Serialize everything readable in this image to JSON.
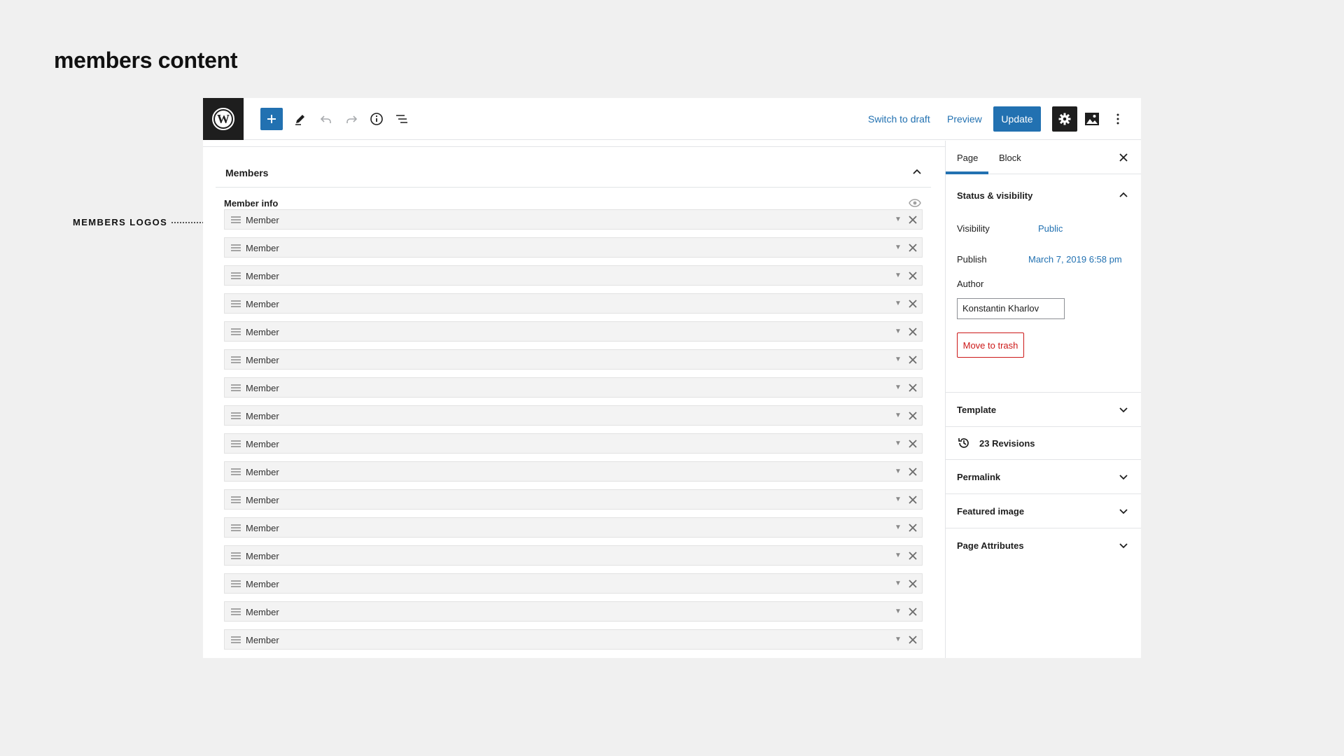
{
  "page_heading": "members content",
  "annotation": {
    "label": "MEMBERS LOGOS"
  },
  "colors": {
    "accent": "#2271b1",
    "danger": "#cc1818",
    "dark": "#1e1e1e"
  },
  "toolbar": {
    "switch_to_draft": "Switch to draft",
    "preview": "Preview",
    "update": "Update",
    "icons": [
      "wordpress-logo-icon",
      "plus-icon",
      "pencil-icon",
      "undo-icon",
      "redo-icon",
      "info-icon",
      "list-view-icon",
      "gear-icon",
      "image-icon",
      "more-vertical-icon"
    ]
  },
  "members_panel": {
    "title": "Members",
    "section_label": "Member info",
    "items": [
      {
        "label": "Member"
      },
      {
        "label": "Member"
      },
      {
        "label": "Member"
      },
      {
        "label": "Member"
      },
      {
        "label": "Member"
      },
      {
        "label": "Member"
      },
      {
        "label": "Member"
      },
      {
        "label": "Member"
      },
      {
        "label": "Member"
      },
      {
        "label": "Member"
      },
      {
        "label": "Member"
      },
      {
        "label": "Member"
      },
      {
        "label": "Member"
      },
      {
        "label": "Member"
      },
      {
        "label": "Member"
      },
      {
        "label": "Member"
      }
    ]
  },
  "sidebar": {
    "tabs": [
      {
        "label": "Page",
        "active": true
      },
      {
        "label": "Block",
        "active": false
      }
    ],
    "status": {
      "title": "Status & visibility",
      "visibility_label": "Visibility",
      "visibility_value": "Public",
      "publish_label": "Publish",
      "publish_value": "March 7, 2019 6:58 pm",
      "author_label": "Author",
      "author_value": "Konstantin Kharlov",
      "trash_label": "Move to trash"
    },
    "template": "Template",
    "revisions": "23 Revisions",
    "permalink": "Permalink",
    "featured_image": "Featured image",
    "page_attributes": "Page Attributes"
  }
}
